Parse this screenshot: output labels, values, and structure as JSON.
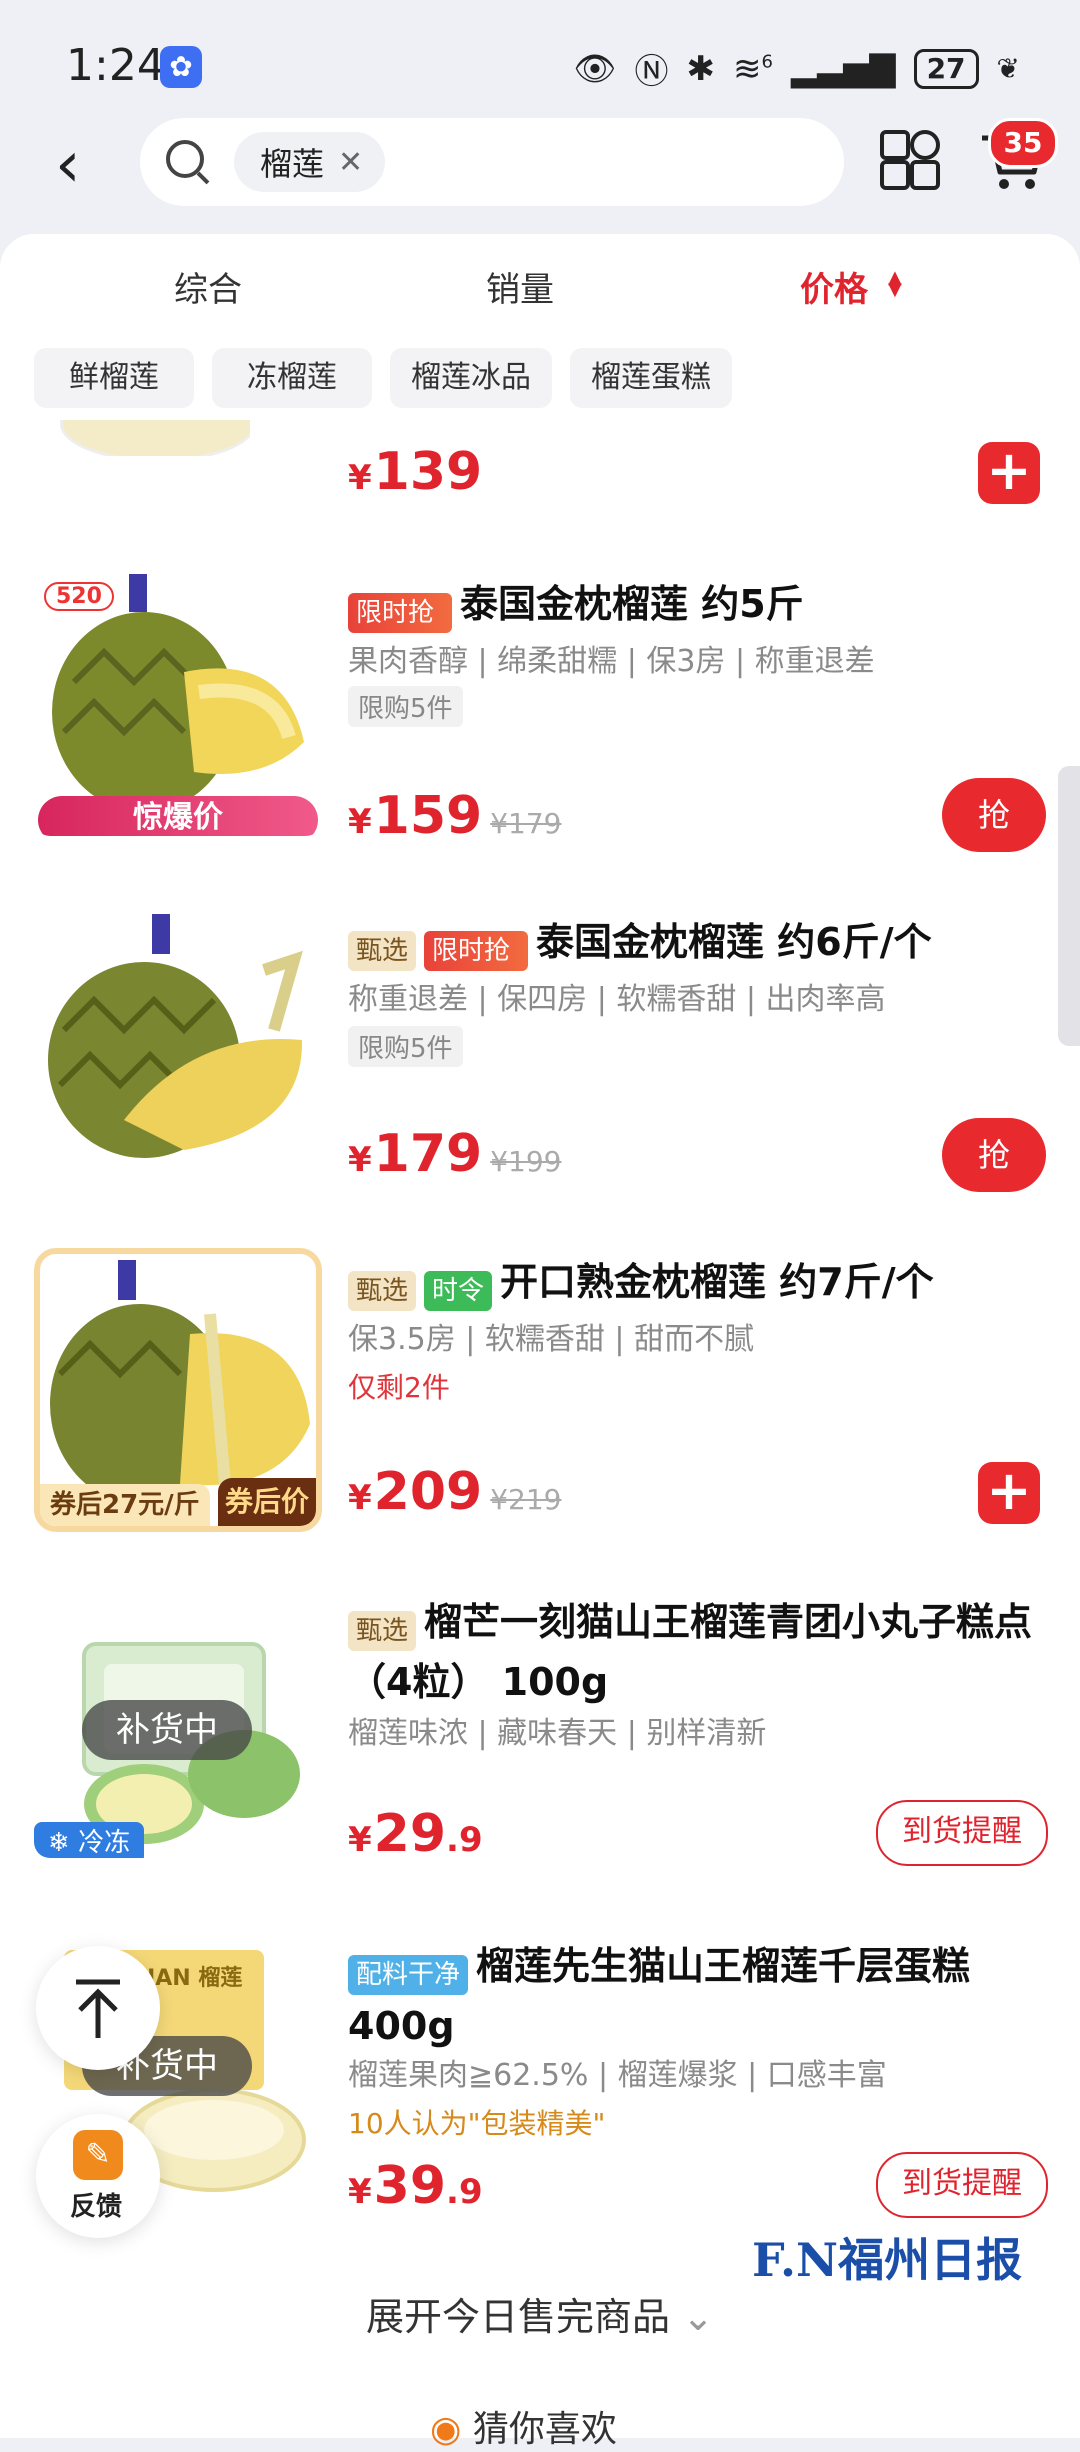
{
  "status_bar": {
    "time": "1:24",
    "battery": "27",
    "signal_label": "6"
  },
  "header": {
    "search_chip": "榴莲",
    "cart_count": "35"
  },
  "sort_tabs": [
    "综合",
    "销量",
    "价格"
  ],
  "filters": [
    "鲜榴莲",
    "冻榴莲",
    "榴莲冰品",
    "榴莲蛋糕"
  ],
  "items": [
    {
      "price_int": "139",
      "price_dec": ""
    },
    {
      "tags": [
        "限时抢"
      ],
      "title": "泰国金枕榴莲 约5斤",
      "sub": "果肉香醇 | 绵柔甜糯 | 保3房 | 称重退差",
      "limit": "限购5件",
      "price_int": "159",
      "orig": "¥179",
      "button": "抢",
      "img_badge": "520",
      "img_banner": "惊爆价"
    },
    {
      "tags": [
        "甄选",
        "限时抢"
      ],
      "title": "泰国金枕榴莲 约6斤/个",
      "sub": "称重退差 | 保四房 | 软糯香甜 | 出肉率高",
      "limit": "限购5件",
      "price_int": "179",
      "orig": "¥199",
      "button": "抢"
    },
    {
      "tags": [
        "甄选",
        "时令"
      ],
      "title": "开口熟金枕榴莲 约7斤/个",
      "sub": "保3.5房 | 软糯香甜 | 甜而不腻",
      "warn": "仅剩2件",
      "price_int": "209",
      "orig": "¥219",
      "img_left": "券后27元/斤",
      "img_right": "券后价"
    },
    {
      "tags": [
        "甄选"
      ],
      "title": "榴芒一刻猫山王榴莲青团小丸子糕点（4粒） 100g",
      "sub": "榴莲味浓 | 藏味春天 | 别样清新",
      "price_int": "29",
      "price_dec": ".9",
      "button": "到货提醒",
      "restock": "补货中",
      "frozen": "冷冻"
    },
    {
      "tags": [
        "配料干净"
      ],
      "title": "榴莲先生猫山王榴莲千层蛋糕 400g",
      "sub": "榴莲果肉≧62.5% | 榴莲爆浆 | 口感丰富",
      "praise": "10人认为\"包装精美\"",
      "price_int": "39",
      "price_dec": ".9",
      "button": "到货提醒",
      "restock": "补货中",
      "img_text": "DURIAN 榴莲"
    }
  ],
  "currency": "¥",
  "feedback_label": "反馈",
  "expand_label": "展开今日售完商品",
  "guess_label": "猜你喜欢",
  "watermark": "F.N福州日报"
}
